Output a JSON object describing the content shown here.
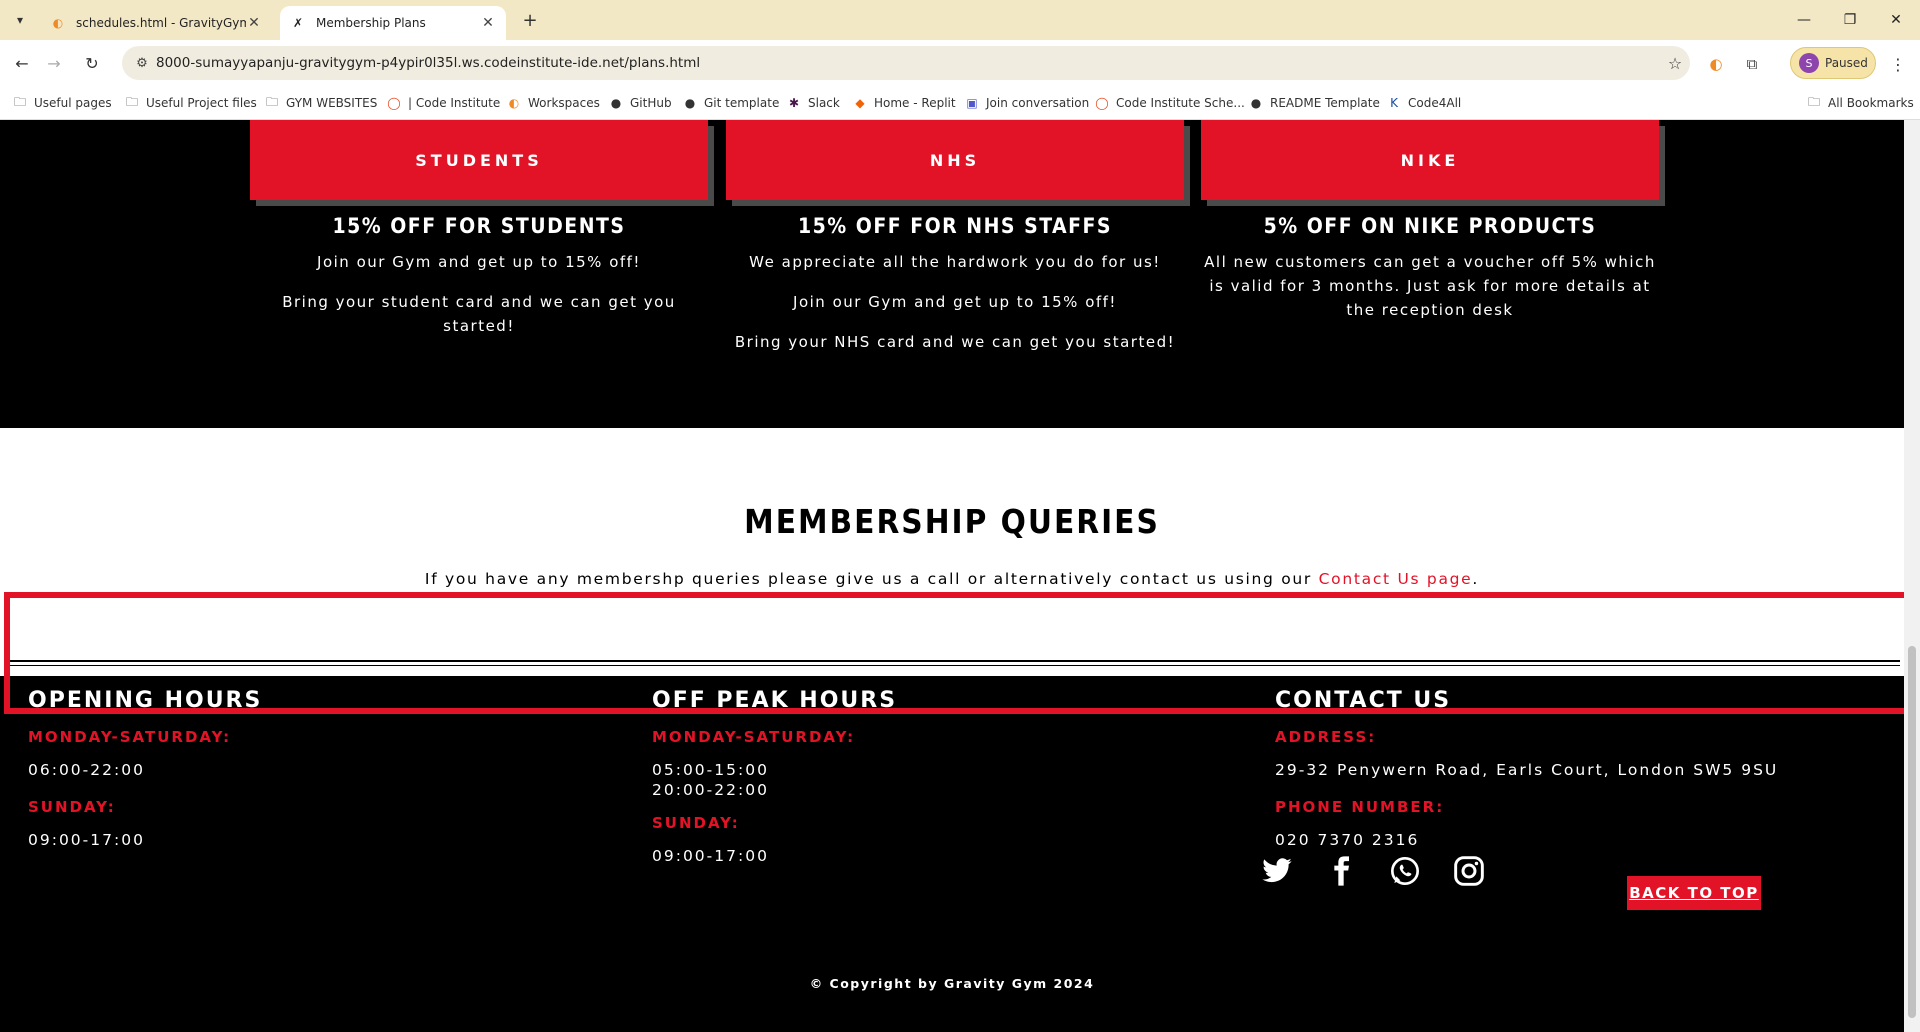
{
  "browser": {
    "tabs": [
      {
        "title": "schedules.html - GravityGym - C",
        "favicon": "gitpod-icon",
        "active": false
      },
      {
        "title": "Membership Plans",
        "favicon": "gym-icon",
        "active": true
      }
    ],
    "url": "8000-sumayyapanju-gravitygym-p4ypir0l35l.ws.codeinstitute-ide.net/plans.html",
    "profile_status": "Paused",
    "profile_initial": "S",
    "bookmarks": [
      "Useful pages",
      "Useful Project files",
      "GYM WEBSITES",
      "| Code Institute",
      "Workspaces",
      "GitHub",
      "Git template",
      "Slack",
      "Home - Replit",
      "Join conversation",
      "Code Institute Sche...",
      "README Template",
      "Code4All"
    ],
    "all_bookmarks": "All Bookmarks"
  },
  "offers": [
    {
      "card": "STUDENTS",
      "title": "15% OFF FOR STUDENTS",
      "lines": [
        "Join our Gym and get up to 15% off!",
        "Bring your student card and we can get you started!"
      ]
    },
    {
      "card": "NHS",
      "title": "15% OFF FOR NHS STAFFS",
      "lines": [
        "We appreciate all the hardwork you do for us!",
        "Join our Gym and get up to 15% off!",
        "Bring your NHS card and we can get you started!"
      ]
    },
    {
      "card": "NIKE",
      "title": "5% OFF ON NIKE PRODUCTS",
      "lines": [
        "All new customers can get a voucher off 5% which is valid for 3 months. Just ask for more details at the reception desk"
      ]
    }
  ],
  "queries": {
    "title": "MEMBERSHIP QUERIES",
    "text": "If you have any membershp queries please give us a call or alternatively contact us using our ",
    "link": "Contact Us page",
    "end": "."
  },
  "footer": {
    "opening": {
      "heading": "OPENING HOURS",
      "label1": "MONDAY-SATURDAY:",
      "value1": "06:00-22:00",
      "label2": "SUNDAY:",
      "value2": "09:00-17:00"
    },
    "offpeak": {
      "heading": "OFF PEAK HOURS",
      "label1": "MONDAY-SATURDAY:",
      "value1a": "05:00-15:00",
      "value1b": "20:00-22:00",
      "label2": "SUNDAY:",
      "value2": "09:00-17:00"
    },
    "contact": {
      "heading": "CONTACT US",
      "label1": "ADDRESS:",
      "value1": "29-32 Penywern Road, Earls Court, London SW5 9SU",
      "label2": "PHONE NUMBER:",
      "value2": "020 7370 2316"
    },
    "socials": [
      "twitter-icon",
      "facebook-icon",
      "whatsapp-icon",
      "instagram-icon"
    ],
    "back_to_top": "BACK TO TOP",
    "copyright": "© Copyright by Gravity Gym 2024"
  },
  "colors": {
    "accent": "#e31327",
    "footer_bg": "#000000",
    "tabstrip_bg": "#f3e8c6"
  }
}
